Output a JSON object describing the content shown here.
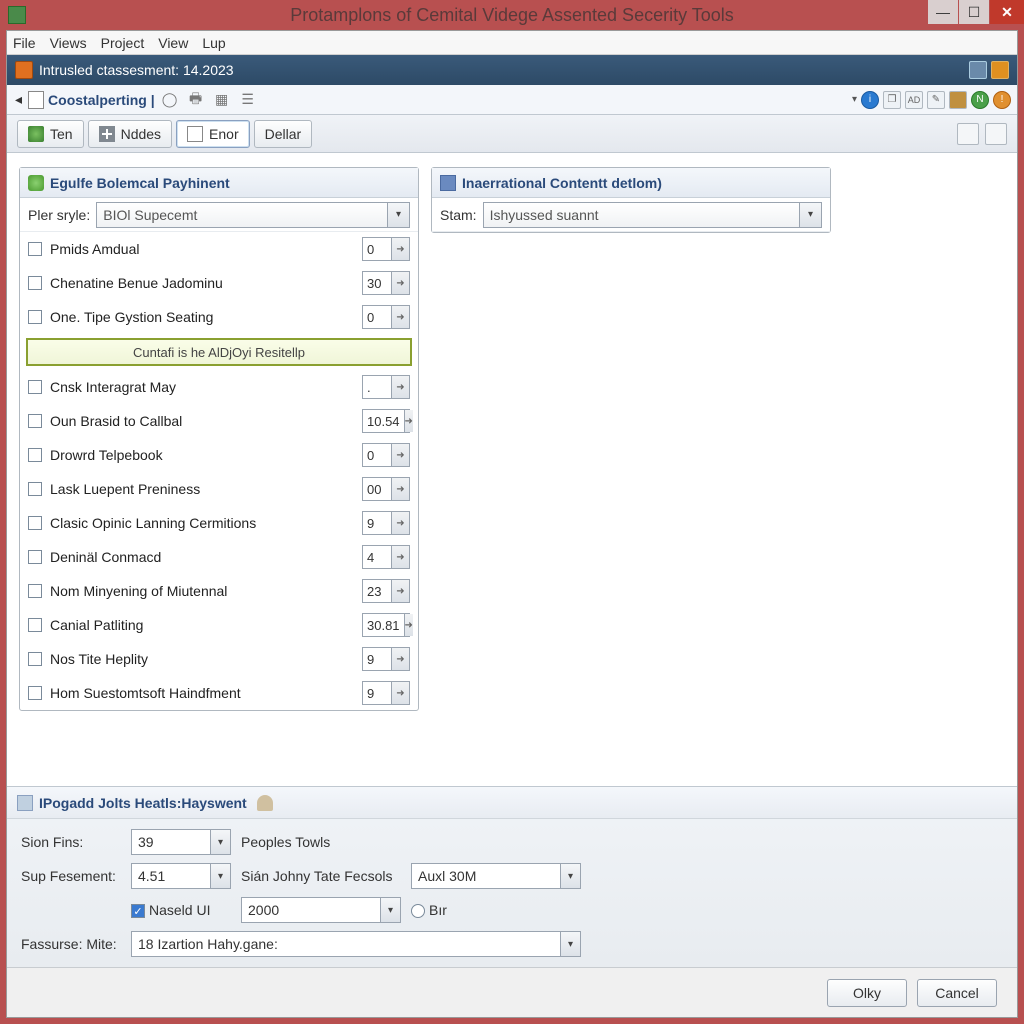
{
  "window": {
    "title": "Protamplons of Cemital Videge Assented Secerity Tools"
  },
  "menubar": [
    "File",
    "Views",
    "Project",
    "View",
    "Lup"
  ],
  "bluestrip": {
    "label": "Intrusled ctassesment: 14.2023"
  },
  "breadcrumb": {
    "label": "Coostalperting |"
  },
  "tabs": [
    {
      "label": "Ten",
      "icon": "green"
    },
    {
      "label": "Nddes",
      "icon": "plus"
    },
    {
      "label": "Enor",
      "icon": "doc",
      "active": true
    },
    {
      "label": "Dellar",
      "icon": ""
    }
  ],
  "leftPanel": {
    "title": "Egulfe Bolemcal Payhinent",
    "styleLabel": "Pler sryle:",
    "styleValue": "BIOl Supecemt",
    "rows": [
      {
        "label": "Pmids Amdual",
        "value": "0"
      },
      {
        "label": "Chenatine Benue Jadominu",
        "value": "30"
      },
      {
        "label": "One. Tipe Gystion Seating",
        "value": "0"
      }
    ],
    "highlight": "Cuntafi is he AlDjOyi Resitellp",
    "rows2": [
      {
        "label": "Cnsk Interagrat May",
        "value": "."
      },
      {
        "label": "Oun Brasid to Callbal",
        "value": "10.54"
      },
      {
        "label": "Drowrd Telpebook",
        "value": "0"
      },
      {
        "label": "Lask Luepent Preniness",
        "value": "00"
      },
      {
        "label": "Clasic Opinic Lanning Cermitions",
        "value": "9"
      },
      {
        "label": "Deninäl Conmacd",
        "value": "4"
      },
      {
        "label": "Nom Minyening of Miutennal",
        "value": "23"
      },
      {
        "label": "Canial Patliting",
        "value": "30.81"
      },
      {
        "label": "Nos Tite Heplity",
        "value": "9"
      },
      {
        "label": "Hom Suestomtsoft Haindfment",
        "value": "9"
      }
    ]
  },
  "rightPanel": {
    "title": "Inaerrational Contentt detlom)",
    "stamLabel": "Stam:",
    "stamValue": "Ishyussed suannt"
  },
  "bottom": {
    "title": "IPogadd Jolts Heatls:Hayswent",
    "sionFinsLabel": "Sion Fins:",
    "sionFinsValue": "39",
    "peoplesTowls": "Peoples Towls",
    "sipLabel": "Sup Fesement:",
    "sipValue": "4.51",
    "sianLabel": "Sián Johny Tate Fecsols",
    "auxValue": "Auxl 30M",
    "naseldLabel": "Naseld UI",
    "naseldValue": "2000",
    "barLabel": "Bır",
    "fassureLabel": "Fassurse: Mite:",
    "fassureValue": "18 Izartion Hahy.gane:"
  },
  "buttons": {
    "ok": "Olky",
    "cancel": "Cancel"
  }
}
